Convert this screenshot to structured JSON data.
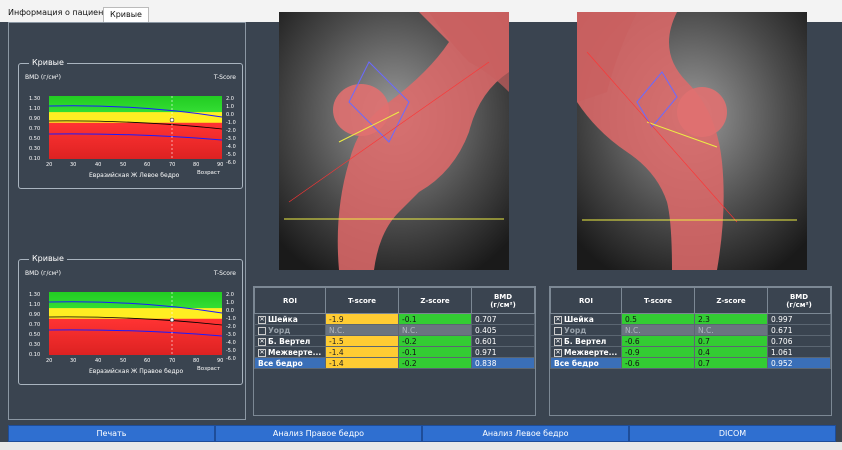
{
  "tabs": [
    "Информация о пациенте",
    "Кривые"
  ],
  "charts": [
    {
      "group_title": "Кривые",
      "ylabel_left": "BMD (г/см²)",
      "ylabel_right": "T-Score",
      "caption": "Евразийская Ж Левое бедро",
      "xlabel": "Возраст",
      "yticks_left": [
        "1.30",
        "1.10",
        "0.90",
        "0.70",
        "0.50",
        "0.30",
        "0.10"
      ],
      "yticks_right": [
        "2.0",
        "1.0",
        "0.0",
        "-1.0",
        "-2.0",
        "-3.0",
        "-4.0",
        "-5.0",
        "-6.0"
      ],
      "xticks": [
        "20",
        "30",
        "40",
        "50",
        "60",
        "70",
        "80",
        "90"
      ]
    },
    {
      "group_title": "Кривые",
      "ylabel_left": "BMD (г/см²)",
      "ylabel_right": "T-Score",
      "caption": "Евразийская Ж Правое бедро",
      "xlabel": "Возраст",
      "yticks_left": [
        "1.30",
        "1.10",
        "0.90",
        "0.70",
        "0.50",
        "0.30",
        "0.10"
      ],
      "yticks_right": [
        "2.0",
        "1.0",
        "0.0",
        "-1.0",
        "-2.0",
        "-3.0",
        "-4.0",
        "-5.0",
        "-6.0"
      ],
      "xticks": [
        "20",
        "30",
        "40",
        "50",
        "60",
        "70",
        "80",
        "90"
      ]
    }
  ],
  "table_headers": [
    "ROI",
    "T-score",
    "Z-score",
    "BMD\n(г/см²)"
  ],
  "table_left": [
    {
      "check": "✕",
      "roi": "Шейка",
      "t": "-1.9",
      "z": "-0.1",
      "bmd": "0.707",
      "tc": "or",
      "zc": "gr"
    },
    {
      "check": "",
      "roi": "Уорд",
      "t": "N.C.",
      "z": "N.C.",
      "bmd": "0.405",
      "tc": "grey",
      "zc": "grey",
      "dim": true
    },
    {
      "check": "✕",
      "roi": "Б. Вертел",
      "t": "-1.5",
      "z": "-0.2",
      "bmd": "0.601",
      "tc": "or",
      "zc": "gr"
    },
    {
      "check": "✕",
      "roi": "Межверте...",
      "t": "-1.4",
      "z": "-0.1",
      "bmd": "0.971",
      "tc": "or",
      "zc": "gr"
    },
    {
      "check": "",
      "roi": "Все бедро",
      "t": "-1.4",
      "z": "-0.2",
      "bmd": "0.838",
      "tc": "or",
      "zc": "gr",
      "sel": true
    }
  ],
  "table_right": [
    {
      "check": "✕",
      "roi": "Шейка",
      "t": "0.5",
      "z": "2.3",
      "bmd": "0.997",
      "tc": "gr",
      "zc": "gr"
    },
    {
      "check": "",
      "roi": "Уорд",
      "t": "N.C.",
      "z": "N.C.",
      "bmd": "0.671",
      "tc": "grey",
      "zc": "grey",
      "dim": true
    },
    {
      "check": "✕",
      "roi": "Б. Вертел",
      "t": "-0.6",
      "z": "0.7",
      "bmd": "0.706",
      "tc": "gr",
      "zc": "gr"
    },
    {
      "check": "✕",
      "roi": "Межверте...",
      "t": "-0.9",
      "z": "0.4",
      "bmd": "1.061",
      "tc": "gr",
      "zc": "gr"
    },
    {
      "check": "",
      "roi": "Все бедро",
      "t": "-0.6",
      "z": "0.7",
      "bmd": "0.952",
      "tc": "gr",
      "zc": "gr",
      "sel": true
    }
  ],
  "buttons": [
    "Печать",
    "Анализ Правое бедро",
    "Анализ Левое бедро",
    "DICOM"
  ]
}
